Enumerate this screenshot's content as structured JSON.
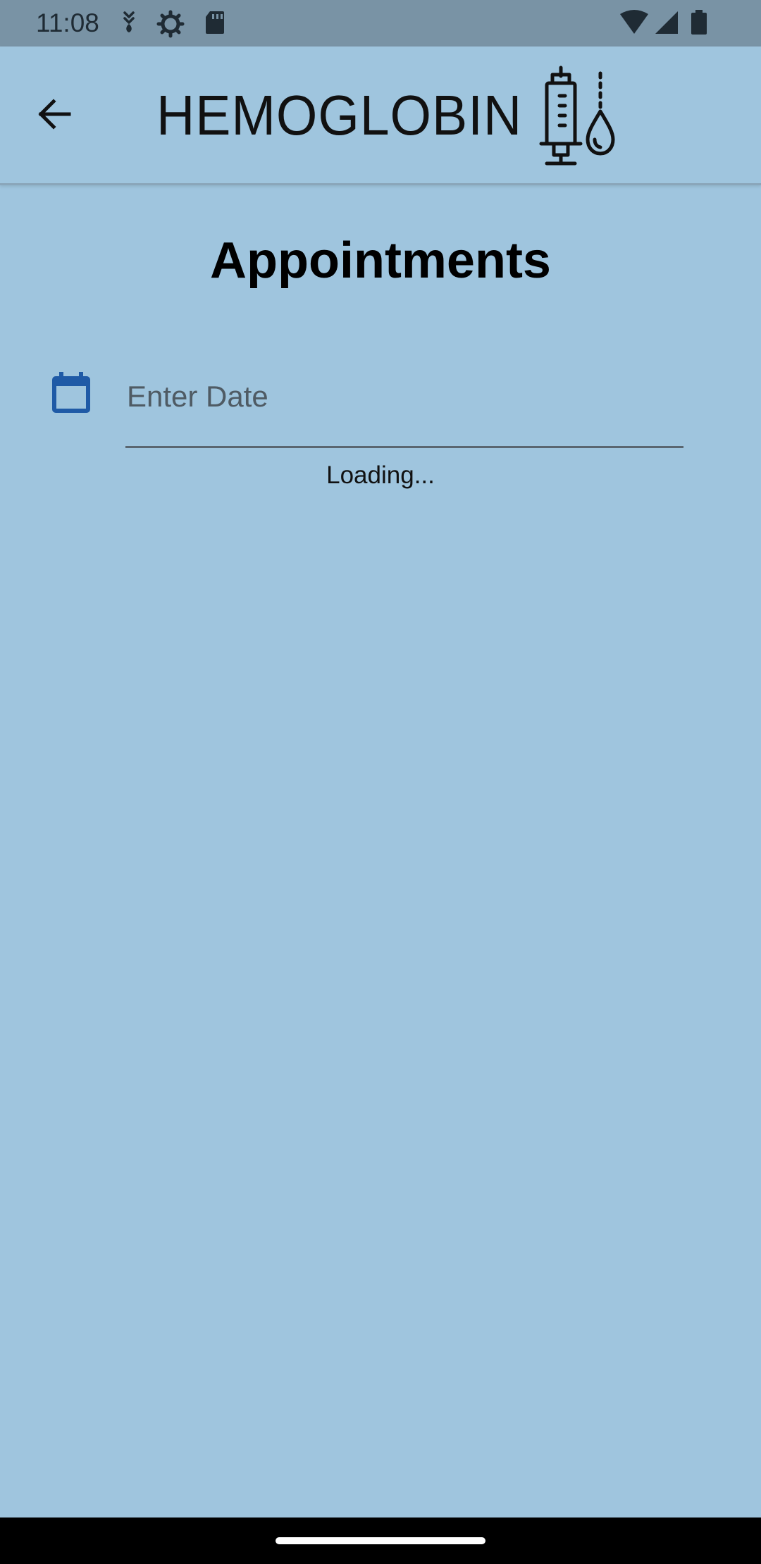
{
  "status_bar": {
    "time": "11:08",
    "left_icons": [
      "download-arrow-icon",
      "settings-gear-icon",
      "sd-card-icon"
    ],
    "right_icons": [
      "wifi-icon",
      "cell-signal-icon",
      "battery-icon"
    ]
  },
  "app_bar": {
    "back_icon": "arrow-left-icon",
    "logo_text": "HEMOGLOBIN",
    "logo_icon": "syringe-blood-drop-icon"
  },
  "page": {
    "title": "Appointments",
    "date_field": {
      "icon": "calendar-icon",
      "placeholder": "Enter Date",
      "value": ""
    },
    "loading_text": "Loading..."
  },
  "colors": {
    "background": "#9fc5de",
    "status_bar": "#7993a5",
    "calendar_accent": "#1f5aa6",
    "text": "#000000"
  }
}
